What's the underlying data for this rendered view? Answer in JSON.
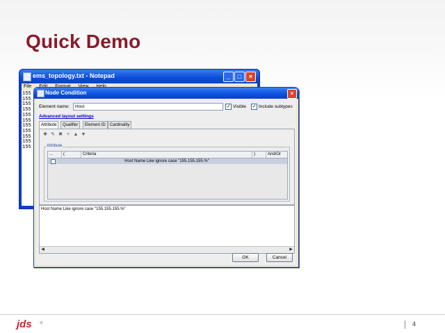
{
  "slide": {
    "title": "Quick Demo",
    "logo": "jds",
    "page_number": "4"
  },
  "notepad": {
    "title": "ems_topology.txt - Notepad",
    "menu": [
      "File",
      "Edit",
      "Format",
      "View",
      "Help"
    ],
    "lines": [
      "155",
      "155",
      "155",
      "155",
      "155",
      "155",
      "155",
      "155",
      "155",
      "155",
      "155"
    ]
  },
  "dialog": {
    "title": "Node Condition",
    "element_name_label": "Element name:",
    "element_name_value": "Host",
    "visible_label": "Visible",
    "visible_checked": true,
    "include_subtypes_label": "Include subtypes",
    "include_subtypes_checked": true,
    "advanced_link": "Advanced layout settings",
    "tabs": [
      "Attribute",
      "Qualifier",
      "Element ID",
      "Cardinality"
    ],
    "active_tab": "Attribute",
    "toolbar_icons": [
      "add-icon",
      "edit-icon",
      "delete-icon",
      "wizard-icon",
      "move-up-icon",
      "move-down-icon"
    ],
    "attribute_group_label": "Attribute",
    "grid": {
      "columns": [
        "...",
        "(",
        "Criteria",
        ")",
        "And/Or"
      ],
      "rows": [
        {
          "checked": false,
          "open_paren": "",
          "criteria": "Host Name  Like ignore case  \"155.155.155.%\"",
          "close_paren": "",
          "and_or": ""
        }
      ]
    },
    "preview_text": "Host Name  Like ignore case  \"155.155.155.%\"",
    "ok_label": "OK",
    "cancel_label": "Cancel"
  }
}
